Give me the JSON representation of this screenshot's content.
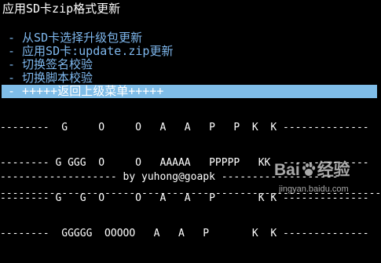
{
  "header": {
    "title": "应用SD卡zip格式更新"
  },
  "menu": {
    "items": [
      {
        "label": "- 从SD卡选择升级包更新"
      },
      {
        "label": "- 应用SD卡:update.zip更新"
      },
      {
        "label": "- 切换签名校验"
      },
      {
        "label": "- 切换脚本校验"
      },
      {
        "label": "- +++++返回上级菜单+++++"
      }
    ],
    "selected_index": 4
  },
  "banner": {
    "lines": [
      "--------  G     O     O   A   A   P   P  K  K --------------",
      "-------- G GGG  O     O   AAAAA   PPPPP   KK  --------------",
      "-------- G   G  O     O   A   A   P       K K --------------",
      "--------  GGGGG  OOOOO   A   A   P       K  K --------------"
    ],
    "byline": "------------------- by yuhong@goapk -------------------",
    "rule": "--------------------------------------------------------------"
  },
  "watermark": {
    "logo_left": "Bai",
    "logo_right": "经验",
    "url": "jingyan.baidu.com"
  },
  "colors": {
    "background": "#000000",
    "text": "#ffffff",
    "menu_text": "#7fb8ee",
    "selection_bg": "#7fbde8"
  }
}
